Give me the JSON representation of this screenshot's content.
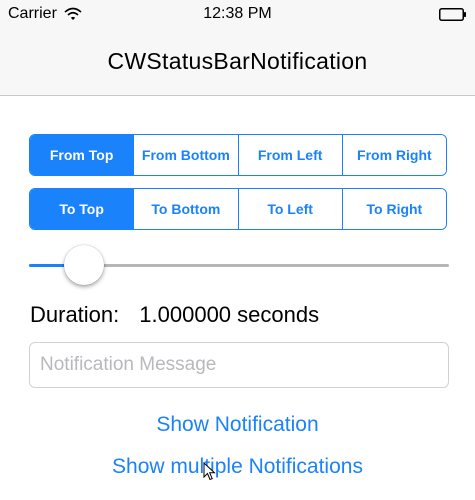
{
  "status_bar": {
    "carrier": "Carrier",
    "time": "12:38 PM",
    "wifi_icon": "wifi-icon",
    "battery_icon": "battery-icon"
  },
  "nav": {
    "title": "CWStatusBarNotification"
  },
  "from_direction": {
    "options": [
      "From Top",
      "From Bottom",
      "From Left",
      "From Right"
    ],
    "selected_index": 0
  },
  "to_direction": {
    "options": [
      "To Top",
      "To Bottom",
      "To Left",
      "To Right"
    ],
    "selected_index": 0
  },
  "duration_slider": {
    "value_fraction": 0.13
  },
  "duration": {
    "label": "Duration:",
    "value": "1.000000 seconds"
  },
  "message": {
    "placeholder": "Notification Message",
    "value": ""
  },
  "actions": {
    "show_notification": "Show Notification",
    "show_multiple": "Show multiple Notifications"
  },
  "colors": {
    "accent": "#1a82fb",
    "bar_background": "#f7f7f7",
    "track": "#b6b6b6"
  }
}
